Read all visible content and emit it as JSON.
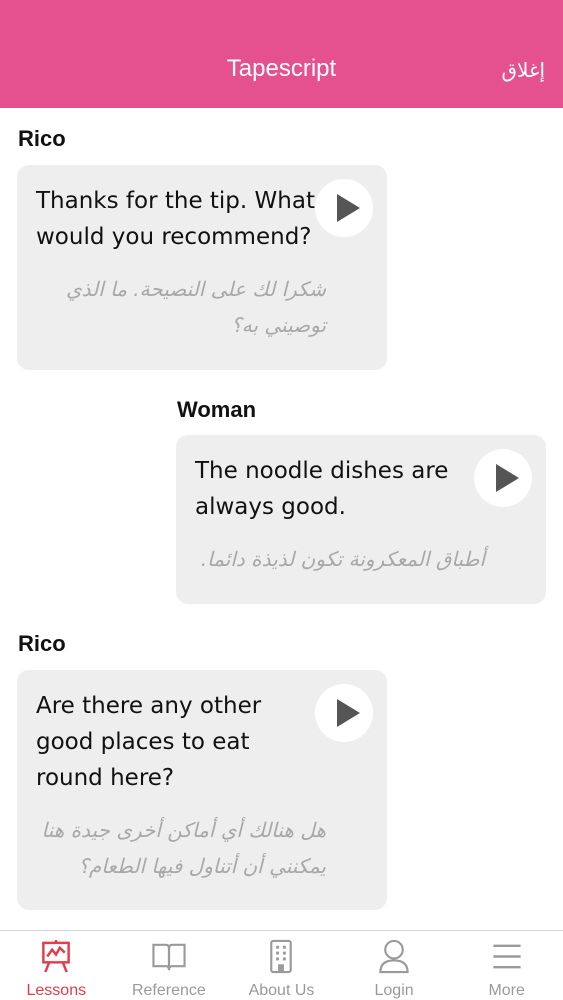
{
  "header": {
    "title": "Tapescript",
    "close_label": "إغلاق",
    "background": "#e5508f"
  },
  "dialogue": [
    {
      "speaker": "Rico",
      "english": "Thanks for the tip. What would you recommend?",
      "arabic": "شكرا لك على النصيحة. ما الذي توصيني به؟",
      "play_icon": "play-icon"
    },
    {
      "speaker": "Woman",
      "english": "The noodle dishes are always good.",
      "arabic": "أطباق المعكرونة تكون لذيذة دائما.",
      "play_icon": "play-icon"
    },
    {
      "speaker": "Rico",
      "english": "Are there any other good places to eat round here?",
      "arabic": "هل هنالك أي أماكن أخرى جيدة هنا يمكنني أن أتناول فيها الطعام؟",
      "play_icon": "play-icon"
    }
  ],
  "tabs": [
    {
      "label": "Lessons",
      "icon": "easel-chart-icon",
      "active": true
    },
    {
      "label": "Reference",
      "icon": "open-book-icon",
      "active": false
    },
    {
      "label": "About Us",
      "icon": "building-icon",
      "active": false
    },
    {
      "label": "Login",
      "icon": "user-icon",
      "active": false
    },
    {
      "label": "More",
      "icon": "hamburger-menu-icon",
      "active": false
    }
  ],
  "colors": {
    "accent": "#e5508f",
    "active_tab": "#e23b4a",
    "inactive_tab": "#9a9a9a",
    "bubble": "#efeeef"
  }
}
